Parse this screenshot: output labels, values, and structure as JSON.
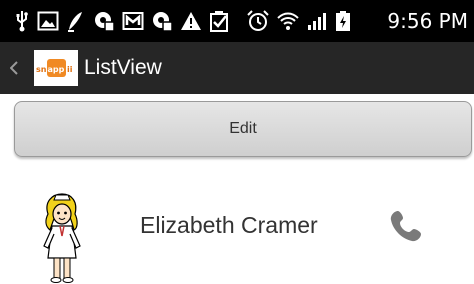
{
  "status_bar": {
    "time": "9:56 PM",
    "icons": [
      "usb-icon",
      "gallery-icon",
      "edit-icon",
      "app-notification-icon",
      "mail-icon",
      "app-notification-icon",
      "warning-icon",
      "clipboard-icon",
      "alarm-icon",
      "wifi-icon",
      "signal-icon",
      "battery-charging-icon"
    ]
  },
  "action_bar": {
    "title": "ListView",
    "logo_text": "snappii",
    "back_icon": "chevron-left-icon"
  },
  "edit_button": {
    "label": "Edit"
  },
  "list": {
    "items": [
      {
        "name": "Elizabeth Cramer",
        "avatar": "nurse-avatar",
        "action_icon": "phone-icon"
      }
    ]
  },
  "colors": {
    "status_bar_bg": "#000000",
    "action_bar_bg": "#262626",
    "button_bg": "#d9d9d9",
    "text_dark": "#333333",
    "phone_icon": "#7a7a7a",
    "logo_orange": "#f08a24"
  }
}
